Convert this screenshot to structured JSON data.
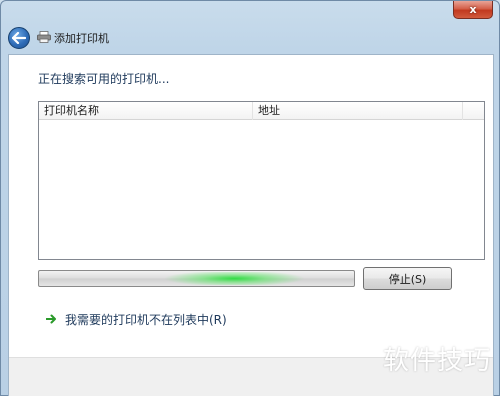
{
  "window": {
    "title": "添加打印机",
    "close_label": "x"
  },
  "main": {
    "heading": "正在搜索可用的打印机...",
    "columns": [
      "打印机名称",
      "地址"
    ],
    "progress": {
      "state": "indeterminate"
    },
    "stop_label": "停止(S)",
    "not_listed_label": "我需要的打印机不在列表中(R)"
  },
  "watermark": "软件技巧",
  "colors": {
    "link_text": "#1e395b",
    "progress_glow": "#28dc3c",
    "arrow": "#2a9a2a"
  }
}
